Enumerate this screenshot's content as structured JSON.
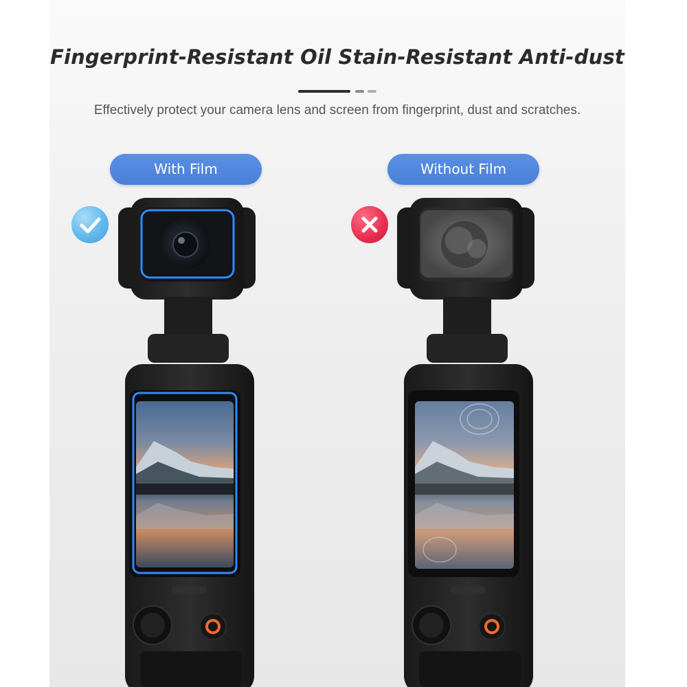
{
  "header": {
    "headline": "Fingerprint-Resistant  Oil Stain-Resistant  Anti-dust",
    "subtitle": "Effectively protect your camera lens and screen from fingerprint, dust and scratches."
  },
  "comparison": {
    "left": {
      "label": "With Film",
      "status_icon": "check-icon"
    },
    "right": {
      "label": "Without Film",
      "status_icon": "cross-icon"
    }
  },
  "colors": {
    "pill": "#4a7fd6",
    "check_badge": "#63b9ec",
    "cross_badge": "#e72d52",
    "film_outline": "#2f8cff",
    "record_button": "#ff6a2a"
  }
}
